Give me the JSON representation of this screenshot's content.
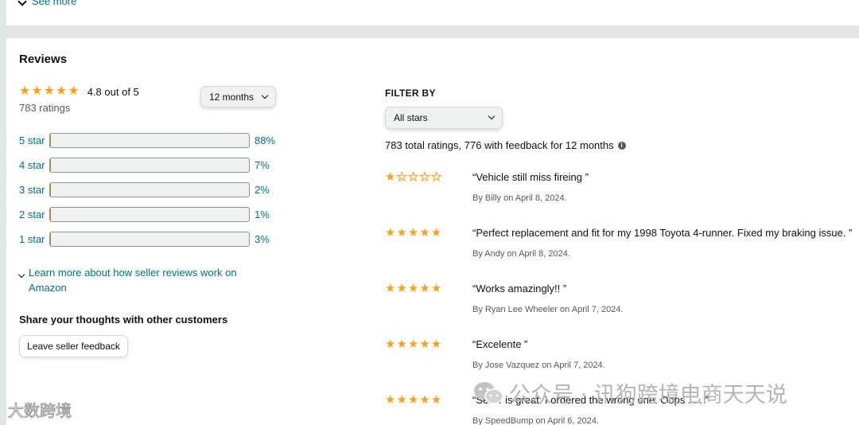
{
  "top": {
    "see_more": "See more"
  },
  "reviews": {
    "title": "Reviews",
    "summary_rating": 4.8,
    "summary_text": "4.8 out of  5",
    "ratings_count": "783 ratings",
    "period_select": "12 months",
    "histogram": [
      {
        "label": "5 star",
        "pct": "88%",
        "value": 88
      },
      {
        "label": "4 star",
        "pct": "7%",
        "value": 7
      },
      {
        "label": "3 star",
        "pct": "2%",
        "value": 2
      },
      {
        "label": "2 star",
        "pct": "1%",
        "value": 1
      },
      {
        "label": "1 star",
        "pct": "3%",
        "value": 3
      }
    ],
    "learn_more": "Learn more about how seller reviews work on Amazon",
    "share_heading": "Share your thoughts with other customers",
    "leave_feedback": "Leave seller feedback"
  },
  "filter": {
    "heading": "FILTER BY",
    "stars_select": "All stars",
    "total_text": "783 total ratings, 776 with feedback for 12 months"
  },
  "review_list": [
    {
      "rating": 1,
      "quote": "“Vehicle still miss fireing ”",
      "by": "By Billy on April 8, 2024."
    },
    {
      "rating": 5,
      "quote": "“Perfect replacement and fit for my 1998 Toyota 4-runner. Fixed my braking issue. ”",
      "by": "By Andy on April 8, 2024."
    },
    {
      "rating": 5,
      "quote": "“Works amazingly!! ”",
      "by": "By Ryan Lee Wheeler on April 7, 2024."
    },
    {
      "rating": 5,
      "quote": "“Excelente ”",
      "by": "By Jose Vazquez on April 7, 2024."
    },
    {
      "rating": 5,
      "quote": "“Seller is great. I ordered the wrong one. Oops . . . ”",
      "by": "By SpeedBump on April 6, 2024."
    }
  ],
  "watermarks": {
    "left": "大数跨境",
    "right": "公众号 · 讯狗跨境电商天天说"
  },
  "colors": {
    "star": "#f7a21f",
    "bar_fill": "#ffa41c",
    "link": "#007185"
  },
  "icons": {
    "see_more": "chevron-down-icon",
    "info": "info-icon",
    "star": "star-icon"
  }
}
